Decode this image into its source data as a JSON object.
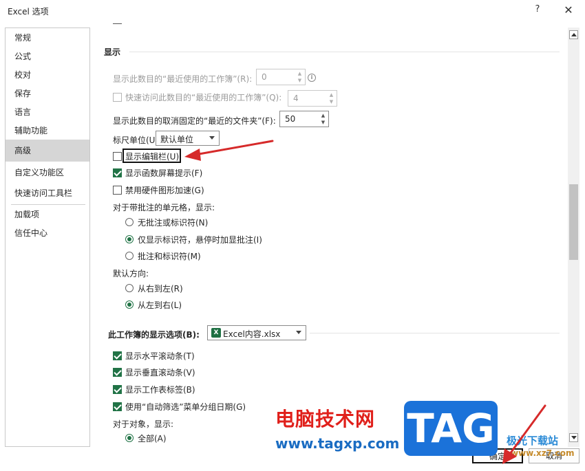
{
  "window": {
    "title": "Excel 选项",
    "help": "?",
    "close": "✕"
  },
  "sidebar": {
    "items": [
      {
        "label": "常规"
      },
      {
        "label": "公式"
      },
      {
        "label": "校对"
      },
      {
        "label": "保存"
      },
      {
        "label": "语言"
      },
      {
        "label": "辅助功能"
      },
      {
        "label": "高级"
      },
      {
        "label": "自定义功能区"
      },
      {
        "label": "快速访问工具栏"
      },
      {
        "label": "加载项"
      },
      {
        "label": "信任中心"
      }
    ],
    "active": "高级"
  },
  "display": {
    "heading": "显示",
    "recent_workbooks_label": "显示此数目的“最近使用的工作簿”(R):",
    "recent_workbooks_value": "0",
    "quick_access_label": "快速访问此数目的“最近使用的工作簿”(Q):",
    "quick_access_value": "4",
    "unpinned_folders_label": "显示此数目的取消固定的“最近的文件夹”(F):",
    "unpinned_folders_value": "50",
    "ruler_units_label": "标尺单位(U)",
    "ruler_units_value": "默认单位",
    "show_formula_bar": "显示编辑栏(U)",
    "show_function_tooltips": "显示函数屏幕提示(F)",
    "disable_hw_accel": "禁用硬件图形加速(G)",
    "comments_heading": "对于带批注的单元格，显示:",
    "comments_none": "无批注或标识符(N)",
    "comments_indicators": "仅显示标识符，悬停时加显批注(I)",
    "comments_all": "批注和标识符(M)",
    "direction_heading": "默认方向:",
    "direction_rtl": "从右到左(R)",
    "direction_ltr": "从左到右(L)"
  },
  "workbook_display": {
    "heading": "此工作簿的显示选项(B):",
    "workbook": "Excel内容.xlsx",
    "h_scroll": "显示水平滚动条(T)",
    "v_scroll": "显示垂直滚动条(V)",
    "sheet_tabs": "显示工作表标签(B)",
    "autofilter_dates": "使用“自动筛选”菜单分组日期(G)",
    "objects_heading": "对于对象，显示:",
    "objects_all": "全部(A)"
  },
  "buttons": {
    "ok": "确定",
    "cancel": "取消"
  },
  "watermark": {
    "site_cn": "电脑技术网",
    "site_url": "www.tagxp.com",
    "tag": "TAG",
    "jg": "极光下载站",
    "xz7": "www.xz7.com"
  },
  "colors": {
    "accent": "#217346",
    "arrow": "#d62a2a"
  }
}
